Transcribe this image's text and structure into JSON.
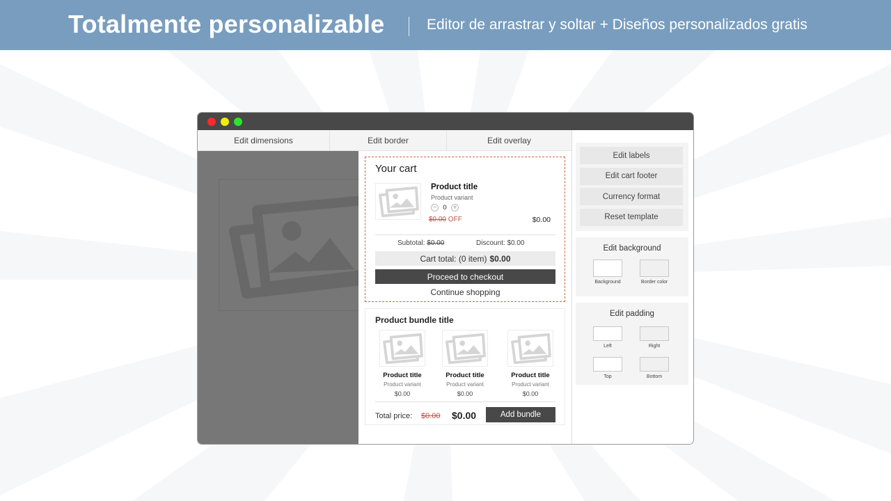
{
  "banner": {
    "title": "Totalmente personalizable",
    "subtitle": "Editor de arrastrar y soltar + Diseños personalizados gratis",
    "background_color": "#789dbf"
  },
  "window": {
    "controls": [
      "close",
      "minimize",
      "maximize"
    ],
    "tabs": [
      {
        "label": "Edit dimensions"
      },
      {
        "label": "Edit border"
      },
      {
        "label": "Edit overlay"
      }
    ]
  },
  "cart": {
    "title": "Your cart",
    "item": {
      "title": "Product title",
      "variant": "Product variant",
      "quantity": "0",
      "minus": "−",
      "plus": "+",
      "old_price": "$0.00",
      "off_label": " OFF",
      "price": "$0.00"
    },
    "subtotal_label": "Subtotal: ",
    "subtotal_value": "$0.00",
    "discount": "Discount: $0.00",
    "total_label": "Cart total: (0 item)",
    "total_value": "$0.00",
    "checkout_label": "Proceed to checkout",
    "continue_label": "Continue shopping",
    "border_color": "#c8673f"
  },
  "bundle": {
    "title": "Product bundle title",
    "items": [
      {
        "title": "Product title",
        "variant": "Product variant",
        "price": "$0.00"
      },
      {
        "title": "Product title",
        "variant": "Product variant",
        "price": "$0.00"
      },
      {
        "title": "Product title",
        "variant": "Product variant",
        "price": "$0.00"
      }
    ],
    "total_label": "Total price:",
    "total_old": "$0.00",
    "total_new": "$0.00",
    "add_label": "Add bundle"
  },
  "sidebar": {
    "menu": [
      {
        "label": "Edit labels"
      },
      {
        "label": "Edit cart footer"
      },
      {
        "label": "Currency format"
      },
      {
        "label": "Reset template"
      }
    ],
    "background_panel": {
      "title": "Edit background",
      "fields": [
        {
          "label": "Background"
        },
        {
          "label": "Border color"
        }
      ]
    },
    "padding_panel": {
      "title": "Edit padding",
      "fields": [
        {
          "label": "Left"
        },
        {
          "label": "Right"
        },
        {
          "label": "Top"
        },
        {
          "label": "Bottom"
        }
      ]
    }
  }
}
